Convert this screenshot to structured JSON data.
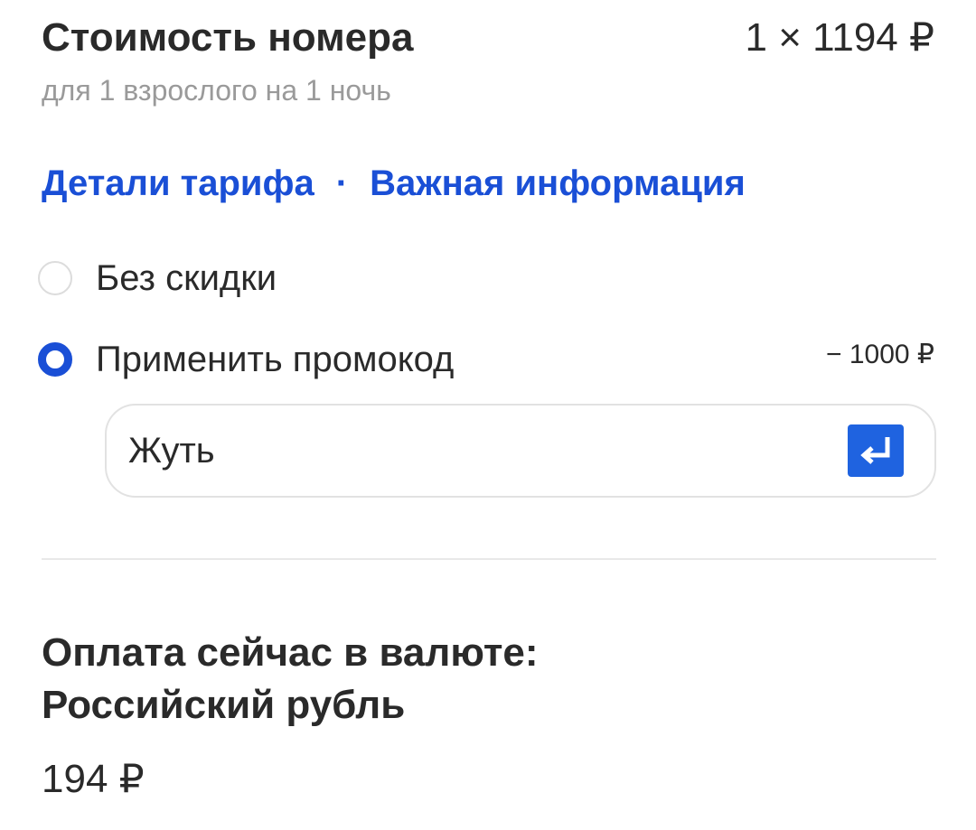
{
  "room": {
    "title": "Стоимость номера",
    "price": "1 × 1194 ₽",
    "subtitle": "для 1 взрослого на 1 ночь"
  },
  "links": {
    "tariff_details": "Детали тарифа",
    "separator": "·",
    "important_info": "Важная информация"
  },
  "options": {
    "no_discount": {
      "label": "Без скидки",
      "selected": false
    },
    "promo_code": {
      "label": "Применить промокод",
      "selected": true,
      "discount": "− 1000 ₽"
    }
  },
  "promo_input": {
    "value": "Жуть",
    "submit_icon": "enter-return-icon"
  },
  "payment": {
    "title_line1": "Оплата сейчас в валюте:",
    "title_line2": "Российский рубль",
    "amount": "194 ₽"
  },
  "colors": {
    "accent": "#1a4fd6",
    "button": "#1f63e0",
    "muted_text": "#9a9a9a",
    "text": "#2a2a2a"
  }
}
